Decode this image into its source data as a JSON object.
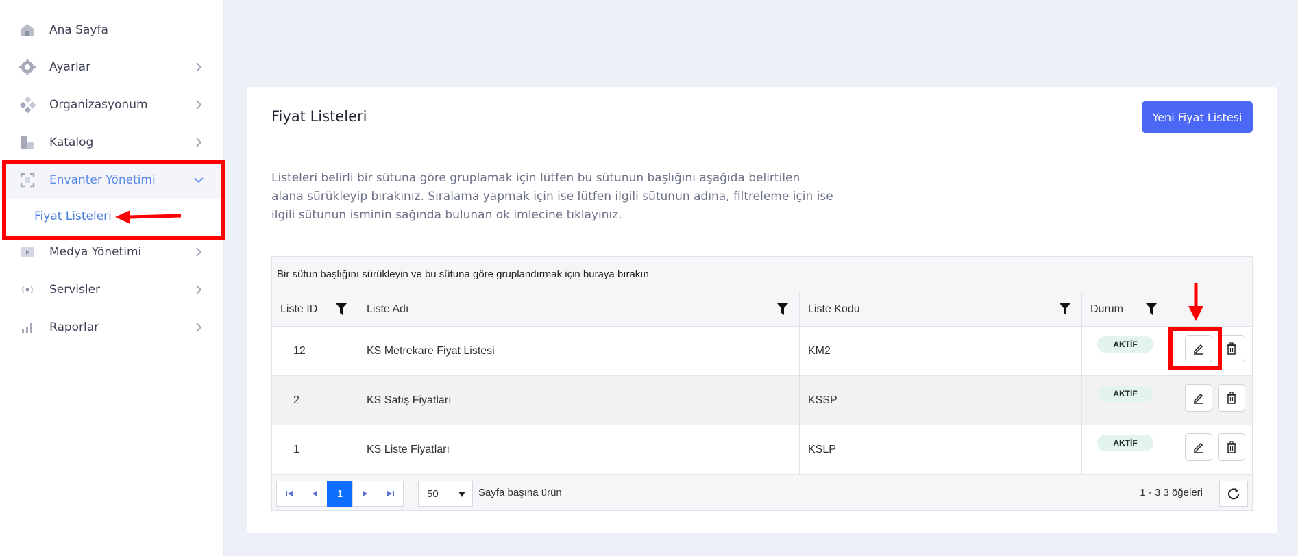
{
  "sidebar": {
    "items": [
      {
        "label": "Ana Sayfa",
        "icon": "home-icon",
        "has_chevron": false
      },
      {
        "label": "Ayarlar",
        "icon": "gear-icon",
        "has_chevron": true
      },
      {
        "label": "Organizasyonum",
        "icon": "organization-icon",
        "has_chevron": true
      },
      {
        "label": "Katalog",
        "icon": "catalog-icon",
        "has_chevron": true
      },
      {
        "label": "Envanter Yönetimi",
        "icon": "inventory-icon",
        "has_chevron": true,
        "expanded": true,
        "active": true
      },
      {
        "label": "Medya Yönetimi",
        "icon": "media-icon",
        "has_chevron": true
      },
      {
        "label": "Servisler",
        "icon": "services-icon",
        "has_chevron": true
      },
      {
        "label": "Raporlar",
        "icon": "reports-icon",
        "has_chevron": true
      }
    ],
    "sub_item": {
      "label": "Fiyat Listeleri",
      "active": true
    }
  },
  "page": {
    "title": "Fiyat Listeleri",
    "new_button": "Yeni Fiyat Listesi",
    "description": "Listeleri belirli bir sütuna göre gruplamak için lütfen bu sütunun başlığını aşağıda belirtilen alana sürükleyip bırakınız. Sıralama yapmak için ise lütfen ilgili sütunun adına, filtreleme için ise ilgili sütunun isminin sağında bulunan ok imlecine tıklayınız."
  },
  "grid": {
    "group_panel": "Bir sütun başlığını sürükleyin ve bu sütuna göre gruplandırmak için buraya bırakın",
    "columns": [
      "Liste ID",
      "Liste Adı",
      "Liste Kodu",
      "Durum"
    ],
    "rows": [
      {
        "id": "12",
        "name": "KS Metrekare Fiyat Listesi",
        "code": "KM2",
        "status": "AKTİF"
      },
      {
        "id": "2",
        "name": "KS Satış Fiyatları",
        "code": "KSSP",
        "status": "AKTİF"
      },
      {
        "id": "1",
        "name": "KS Liste Fiyatları",
        "code": "KSLP",
        "status": "AKTİF"
      }
    ]
  },
  "pager": {
    "current_page": "1",
    "page_size": "50",
    "page_size_label": "Sayfa başına ürün",
    "info": "1 - 3 3 öğeleri"
  },
  "colors": {
    "accent": "#4a67f5",
    "annotation": "#ff0000",
    "active_nav": "#5b8be8",
    "badge_bg": "#e3f4ee"
  }
}
